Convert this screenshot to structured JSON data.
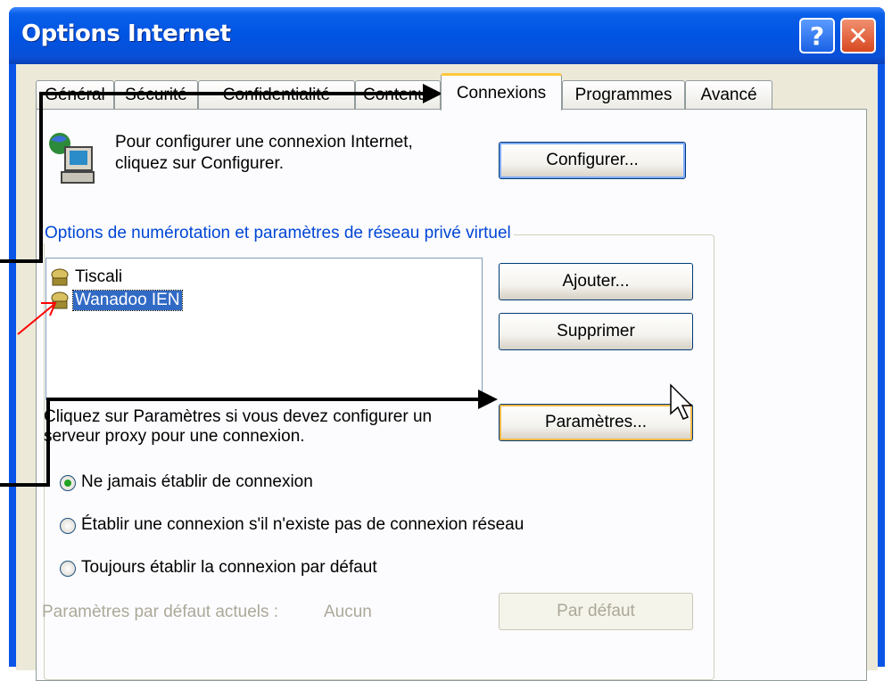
{
  "window": {
    "title": "Options Internet"
  },
  "titlebar_buttons": {
    "help": "?",
    "close": "✕"
  },
  "tabs": [
    {
      "label": "Général"
    },
    {
      "label": "Sécurité"
    },
    {
      "label": "Confidentialité"
    },
    {
      "label": "Contenu"
    },
    {
      "label": "Connexions"
    },
    {
      "label": "Programmes"
    },
    {
      "label": "Avancé"
    }
  ],
  "setup": {
    "text_line1": "Pour configurer une connexion Internet,",
    "text_line2": "cliquez sur Configurer.",
    "button": "Configurer..."
  },
  "dialup_group": {
    "label": "Options de numérotation et paramètres de réseau privé virtuel",
    "items": [
      {
        "label": "Tiscali",
        "selected": false
      },
      {
        "label": "Wanadoo IEN",
        "selected": true
      }
    ],
    "add_button": "Ajouter...",
    "remove_button": "Supprimer"
  },
  "proxy": {
    "text_line1": "Cliquez sur Paramètres si vous devez configurer un",
    "text_line2": "serveur proxy pour une connexion.",
    "button": "Paramètres..."
  },
  "dial_options": [
    {
      "label": "Ne jamais établir de connexion",
      "checked": true
    },
    {
      "label": "Établir une connexion s'il n'existe pas de connexion réseau",
      "checked": false
    },
    {
      "label": "Toujours établir la connexion par défaut",
      "checked": false
    }
  ],
  "defaults": {
    "label": "Paramètres par défaut actuels :",
    "value": "Aucun",
    "button": "Par défaut"
  },
  "colors": {
    "accent": "#0054e3",
    "group_label": "#0046d5",
    "selection": "#316ac5",
    "annotation_red": "#ff0000"
  }
}
